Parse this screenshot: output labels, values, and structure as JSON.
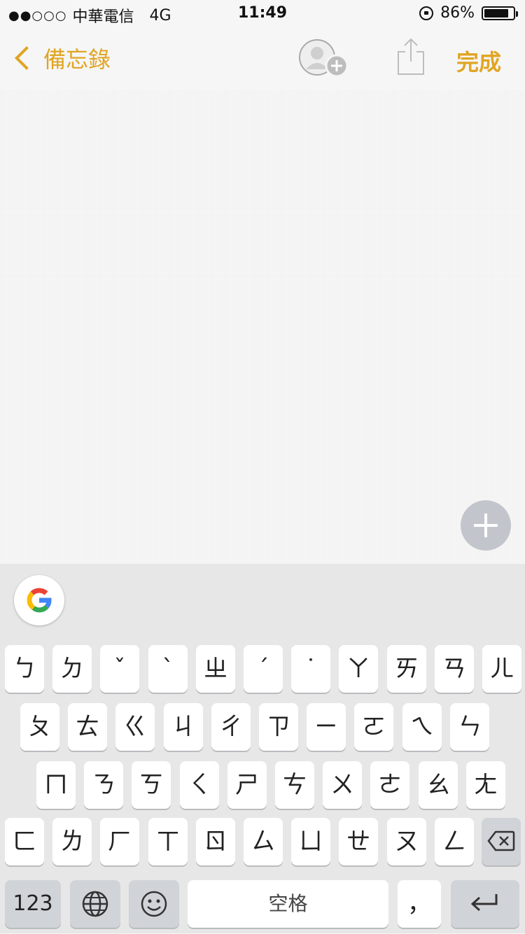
{
  "status_bar": {
    "signal": "●●○○○",
    "carrier": "中華電信",
    "network": "4G",
    "time": "11:49",
    "battery_percent": "86%",
    "battery_level": 0.86
  },
  "nav": {
    "back_label": "備忘錄",
    "done_label": "完成",
    "accent_color": "#e0a523"
  },
  "note": {
    "body": ""
  },
  "keyboard": {
    "row1": [
      "ㄅ",
      "ㄉ",
      "ˇ",
      "ˋ",
      "ㄓ",
      "ˊ",
      "˙",
      "ㄚ",
      "ㄞ",
      "ㄢ",
      "ㄦ"
    ],
    "row2": [
      "ㄆ",
      "ㄊ",
      "ㄍ",
      "ㄐ",
      "ㄔ",
      "ㄗ",
      "ㄧ",
      "ㄛ",
      "ㄟ",
      "ㄣ"
    ],
    "row3": [
      "ㄇ",
      "ㄋ",
      "ㄎ",
      "ㄑ",
      "ㄕ",
      "ㄘ",
      "ㄨ",
      "ㄜ",
      "ㄠ",
      "ㄤ"
    ],
    "row4": [
      "ㄈ",
      "ㄌ",
      "ㄏ",
      "ㄒ",
      "ㄖ",
      "ㄙ",
      "ㄩ",
      "ㄝ",
      "ㄡ",
      "ㄥ"
    ],
    "numbers_label": "123",
    "space_label": "空格",
    "comma_label": "，",
    "icons": [
      "google-icon",
      "globe-icon",
      "emoji-icon",
      "backspace-icon",
      "return-icon"
    ]
  }
}
